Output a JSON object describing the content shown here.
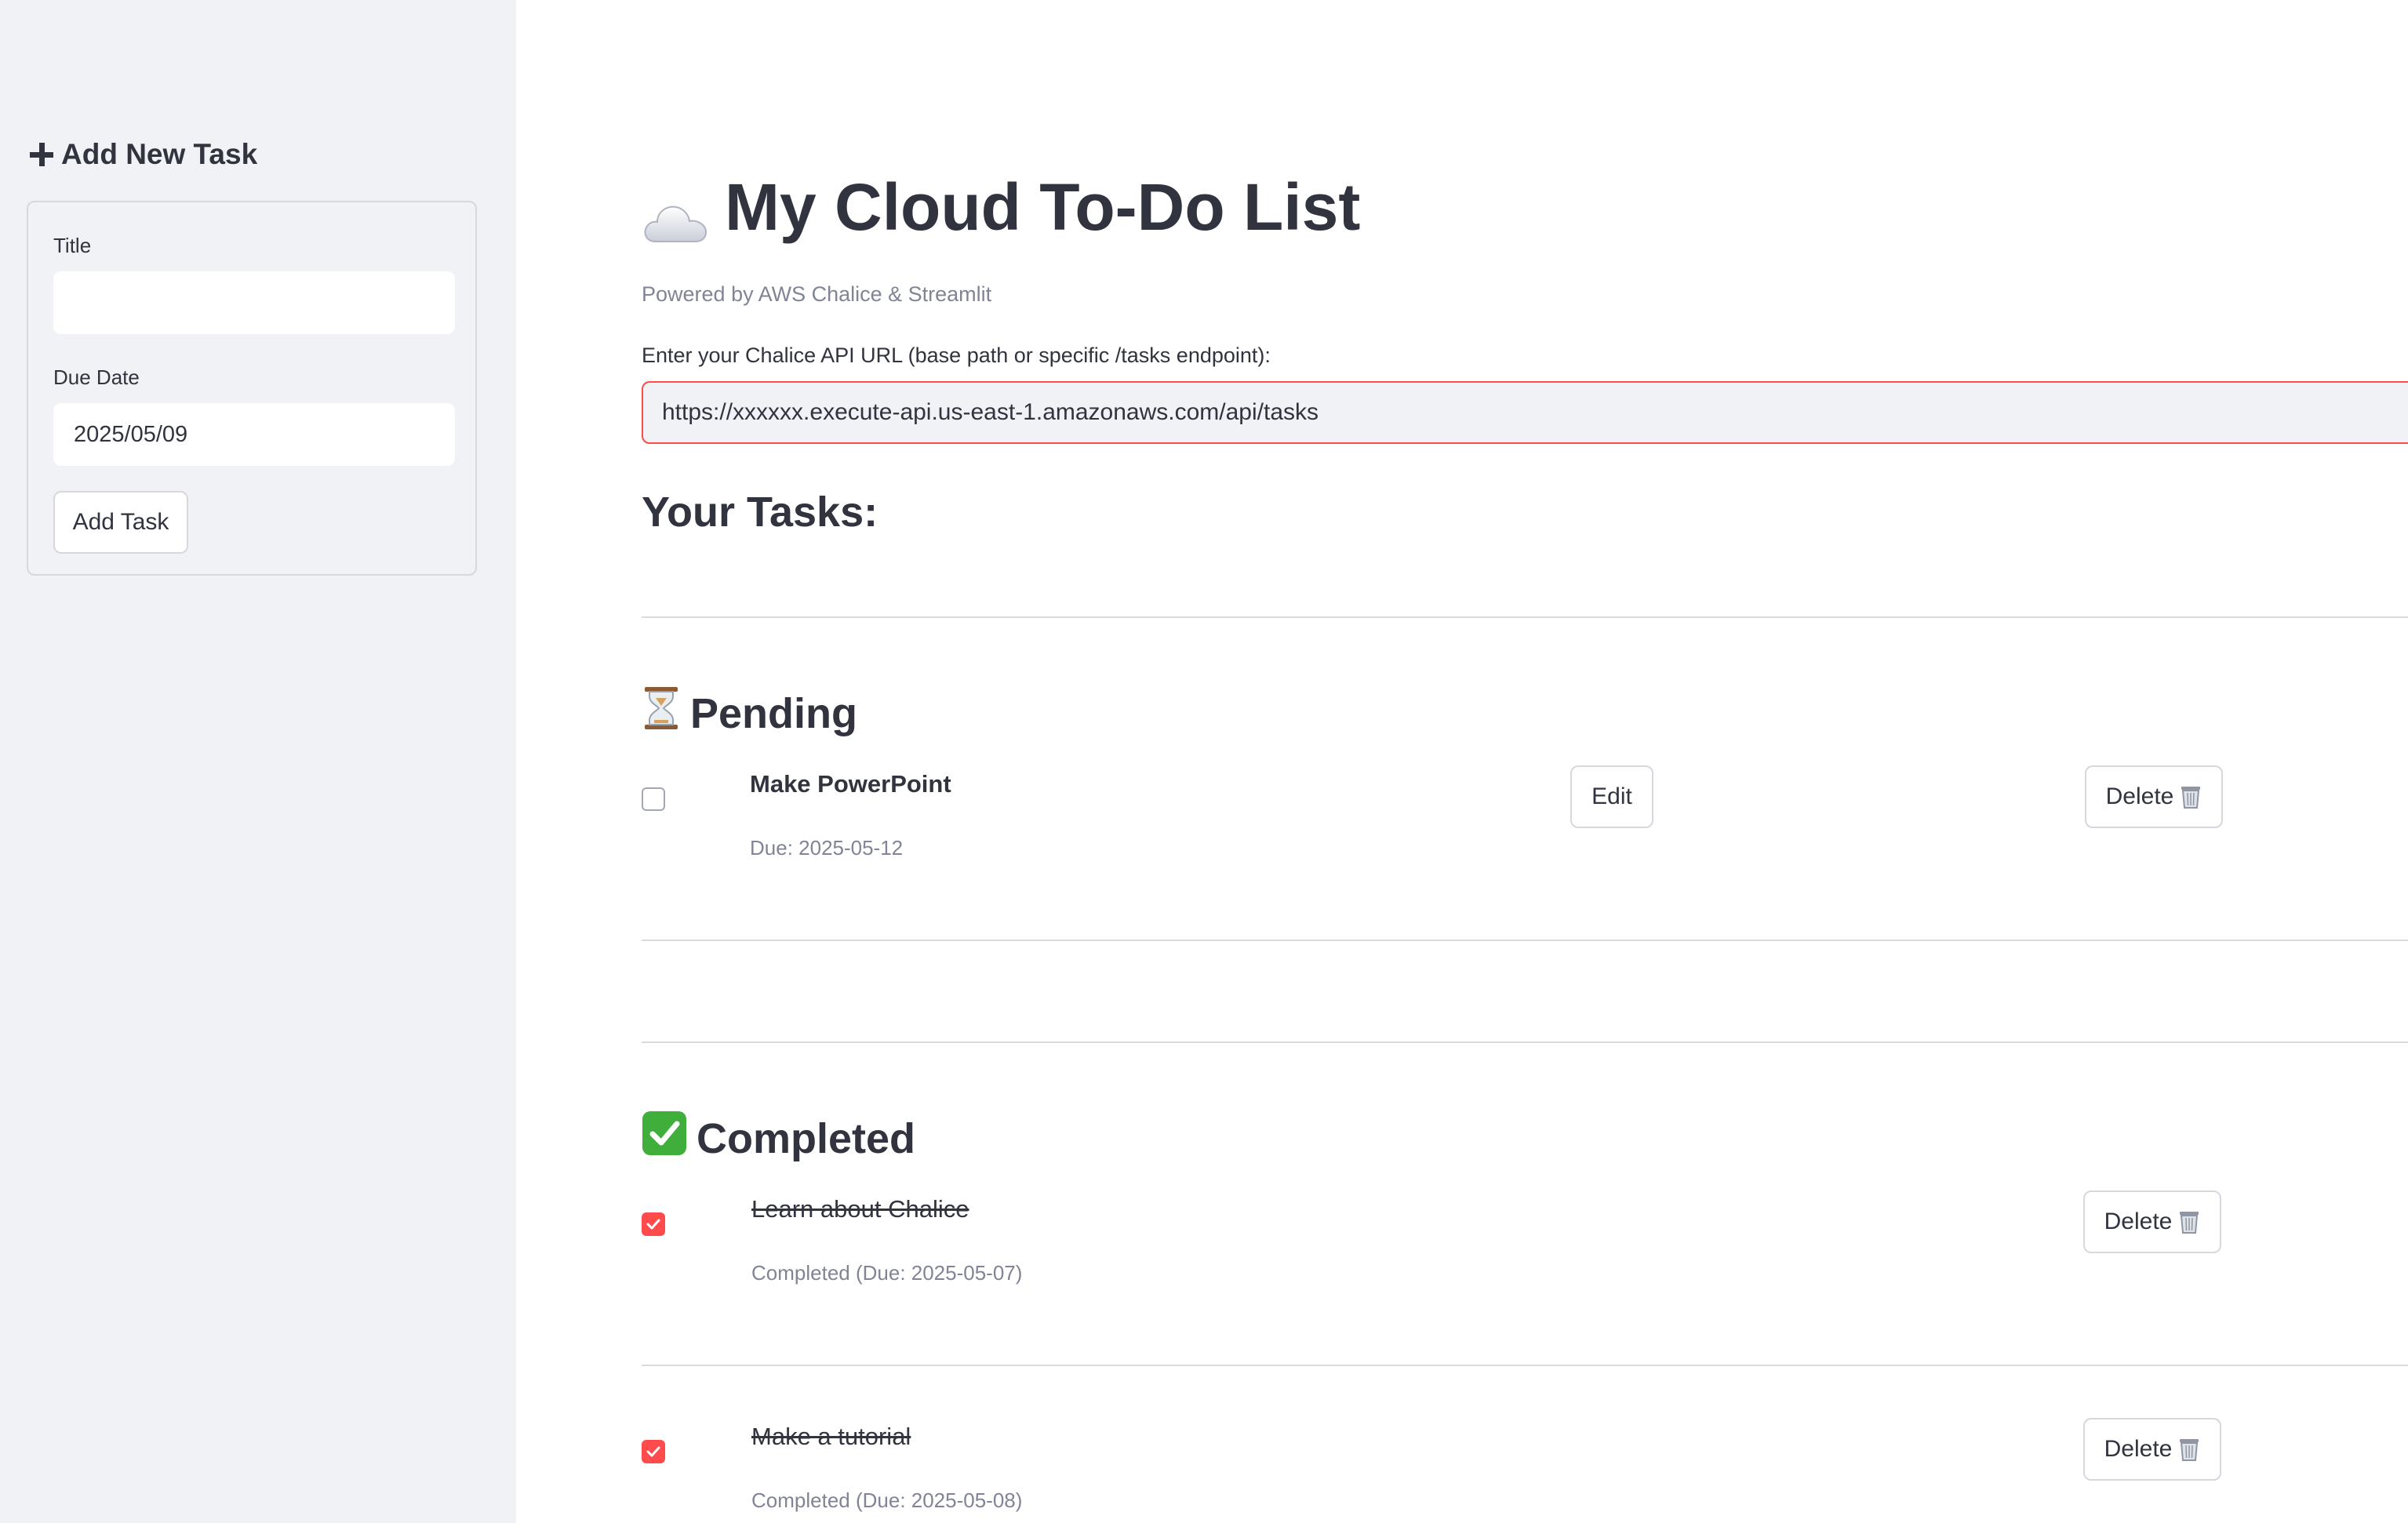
{
  "sidebar": {
    "header": "Add New Task",
    "form": {
      "title_label": "Title",
      "title_value": "",
      "due_label": "Due Date",
      "due_value": "2025/05/09",
      "submit_label": "Add Task"
    }
  },
  "main": {
    "title": "My Cloud To-Do List",
    "caption": "Powered by AWS Chalice & Streamlit",
    "url_label": "Enter your Chalice API URL (base path or specific /tasks endpoint):",
    "url_value": "https://xxxxxx.execute-api.us-east-1.amazonaws.com/api/tasks",
    "tasks_heading": "Your Tasks:",
    "pending": {
      "heading": "Pending",
      "tasks": [
        {
          "title": "Make PowerPoint",
          "meta": "Due: 2025-05-12",
          "edit_label": "Edit",
          "delete_label": "Delete"
        }
      ]
    },
    "completed": {
      "heading": "Completed",
      "tasks": [
        {
          "title": "Learn about Chalice",
          "meta": "Completed (Due: 2025-05-07)",
          "delete_label": "Delete"
        },
        {
          "title": "Make a tutorial",
          "meta": "Completed (Due: 2025-05-08)",
          "delete_label": "Delete"
        }
      ]
    }
  },
  "icons": {
    "add": "plus-icon",
    "title": "cloud-icon",
    "pending": "hourglass-icon",
    "completed": "check-mark-button-icon",
    "delete": "wastebasket-icon"
  },
  "colors": {
    "accent": "#ff4b4b",
    "sidebar_bg": "#f0f2f6",
    "text": "#31333f",
    "muted": "#808495"
  }
}
